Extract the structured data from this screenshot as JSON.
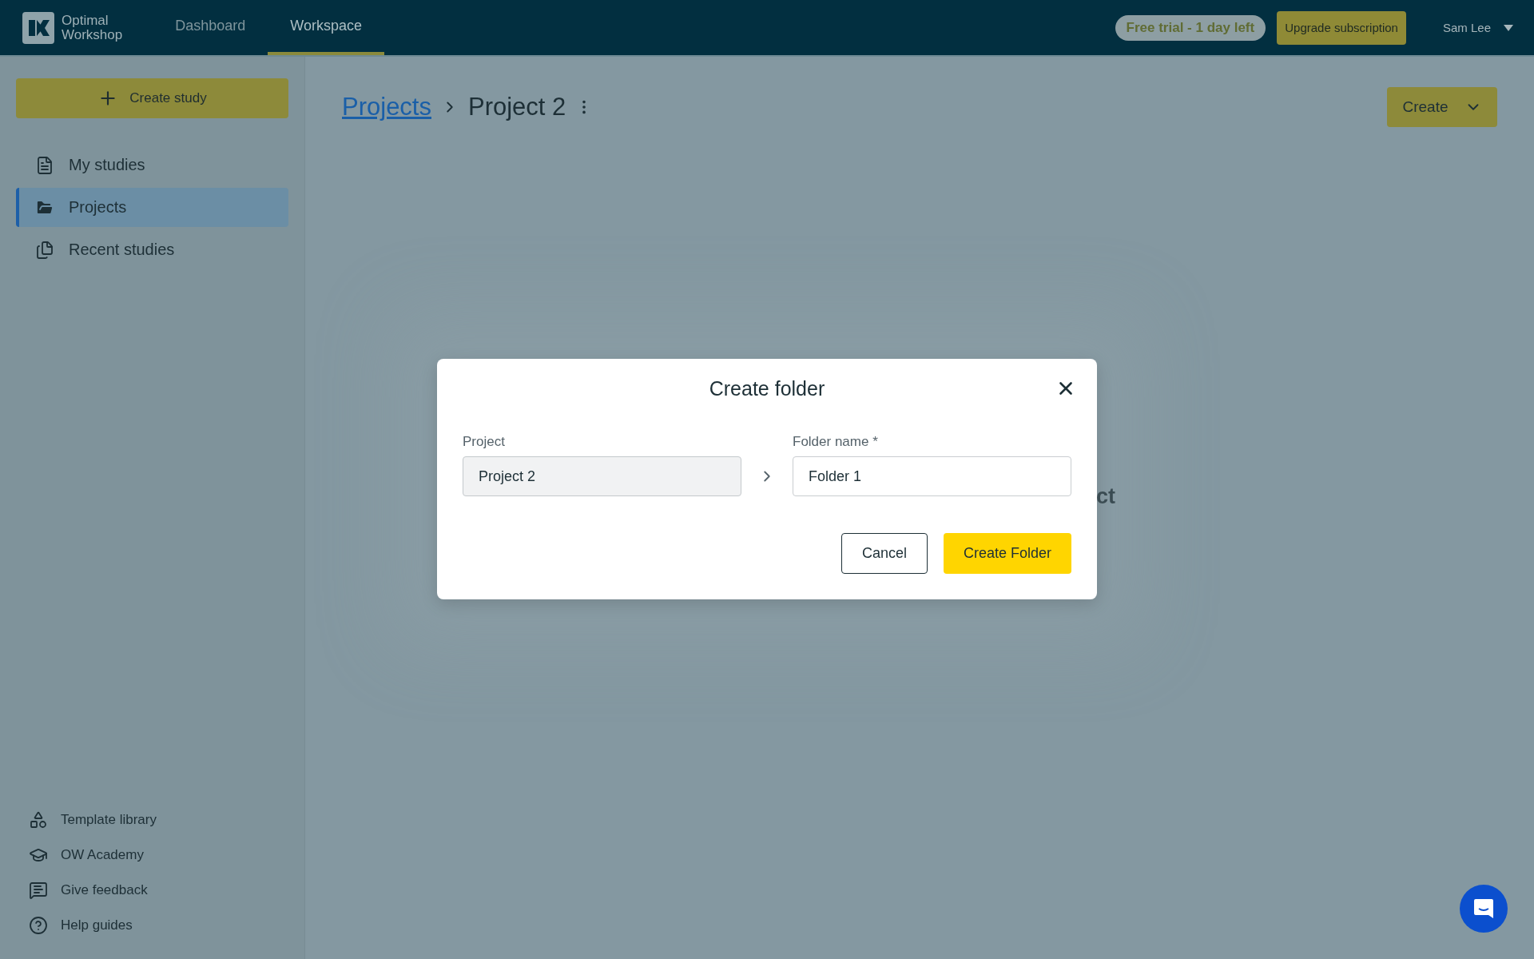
{
  "top_bar": {
    "logo_lines": [
      "Optimal",
      "Workshop"
    ],
    "nav": [
      {
        "label": "Dashboard",
        "selected": false
      },
      {
        "label": "Workspace",
        "selected": true
      }
    ],
    "trial_badge": "Free trial - 1 day left",
    "upgrade_button": "Upgrade subscription",
    "user": "Sam Lee"
  },
  "sidebar": {
    "create_button": "Create study",
    "items": [
      {
        "label": "My studies",
        "kind": "studies",
        "selected": false
      },
      {
        "label": "Projects",
        "kind": "projects",
        "selected": true
      },
      {
        "label": "Recent studies",
        "kind": "recent",
        "selected": false
      }
    ],
    "footer_items": [
      {
        "label": "Template library",
        "kind": "templates"
      },
      {
        "label": "OW Academy",
        "kind": "academy"
      },
      {
        "label": "Give feedback",
        "kind": "feedback"
      },
      {
        "label": "Help guides",
        "kind": "help"
      }
    ]
  },
  "breadcrumb": [
    "Projects",
    "Project 2"
  ],
  "create_button": "Create",
  "empty_state_fragment": "ct",
  "dialog": {
    "title": "Create folder",
    "fields": [
      {
        "label": "Project",
        "value": "Project 2",
        "disabled": true
      },
      {
        "label": "Folder name *",
        "value": "Folder 1",
        "disabled": false
      }
    ],
    "buttons": [
      {
        "label": "Cancel",
        "kind": "secondary"
      },
      {
        "label": "Create Folder",
        "kind": "primary"
      }
    ]
  }
}
